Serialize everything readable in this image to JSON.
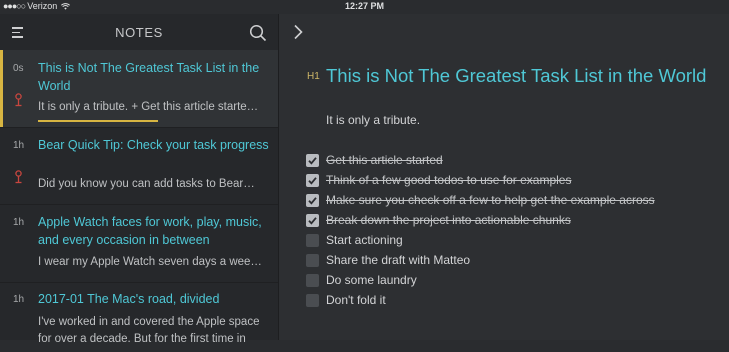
{
  "statusbar": {
    "carrier": "Verizon",
    "signal_dots": "●●●○○",
    "time": "12:27 PM"
  },
  "sidebar": {
    "title": "NOTES",
    "notes": [
      {
        "age": "0s",
        "title": "This is Not The Greatest Task List in the World",
        "excerpt": "It is only a tribute. + Get this article starte…",
        "pinned": true,
        "selected": true
      },
      {
        "age": "1h",
        "title": "Bear Quick Tip: Check your task progress",
        "excerpt": "Did you know you can add tasks to Bear…",
        "pinned": true,
        "selected": false
      },
      {
        "age": "1h",
        "title": "Apple Watch faces for work, play, music, and every occasion in between",
        "excerpt": "I wear my Apple Watch seven days a wee…",
        "pinned": false,
        "selected": false
      },
      {
        "age": "1h",
        "title": "2017-01 The Mac's road, divided",
        "excerpt": "I've worked in and covered the Apple space for over a decade. But for the first time in",
        "pinned": false,
        "selected": false
      }
    ]
  },
  "editor": {
    "heading_marker": "H1",
    "title": "This is Not The Greatest Task List in the World",
    "intro": "It is only a tribute.",
    "tasks": [
      {
        "text": "Get this article started",
        "done": true
      },
      {
        "text": "Think of a few good todos to use for examples",
        "done": true
      },
      {
        "text": "Make sure you check off a few to help get the example across",
        "done": true
      },
      {
        "text": "Break down the project into actionable chunks",
        "done": true
      },
      {
        "text": "Start actioning",
        "done": false
      },
      {
        "text": "Share the draft with Matteo",
        "done": false
      },
      {
        "text": "Do some laundry",
        "done": false
      },
      {
        "text": "Don't fold it",
        "done": false
      }
    ]
  },
  "colors": {
    "accent_teal": "#4fc8d6",
    "accent_gold": "#d7b542",
    "pin_red": "#c8463f"
  }
}
